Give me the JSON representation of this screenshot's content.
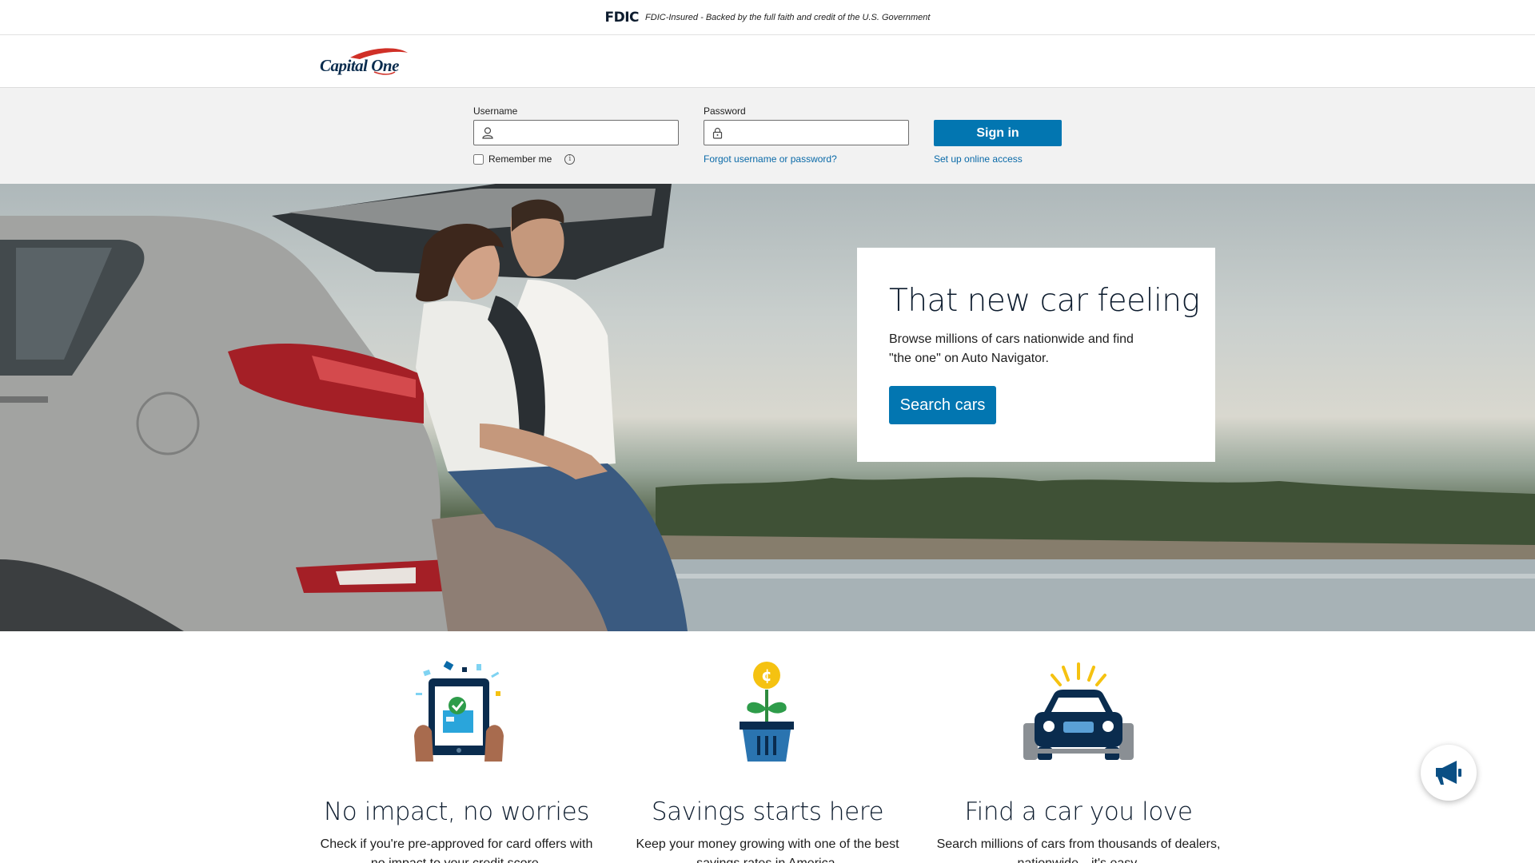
{
  "fdic": {
    "logo": "FDIC",
    "text": "FDIC-Insured - Backed by the full faith and credit of the U.S. Government"
  },
  "brand": {
    "name": "Capital One",
    "colors": {
      "navy": "#0a2c4e",
      "red": "#d03027"
    }
  },
  "signin": {
    "username_label": "Username",
    "username_value": "",
    "password_label": "Password",
    "password_value": "",
    "remember_label": "Remember me",
    "remember_checked": false,
    "forgot_link": "Forgot username or password?",
    "signin_button": "Sign in",
    "setup_link": "Set up online access",
    "icons": [
      "user-icon",
      "lock-icon",
      "info-icon"
    ]
  },
  "hero": {
    "title": "That new car feeling",
    "text": "Browse millions of cars nationwide and find \"the one\" on Auto Navigator.",
    "button": "Search cars"
  },
  "features": [
    {
      "icon": "tablet-approval-icon",
      "title": "No impact, no worries",
      "text": "Check if you're pre-approved for card offers with no impact to your credit score."
    },
    {
      "icon": "savings-plant-icon",
      "title": "Savings starts here",
      "text": "Keep your money growing with one of the best savings rates in America."
    },
    {
      "icon": "car-icon",
      "title": "Find a car you love",
      "text": "Search millions of cars from thousands of dealers, nationwide—it's easy."
    }
  ],
  "feedback": {
    "icon": "megaphone-icon"
  },
  "accent_color": "#0276b1"
}
